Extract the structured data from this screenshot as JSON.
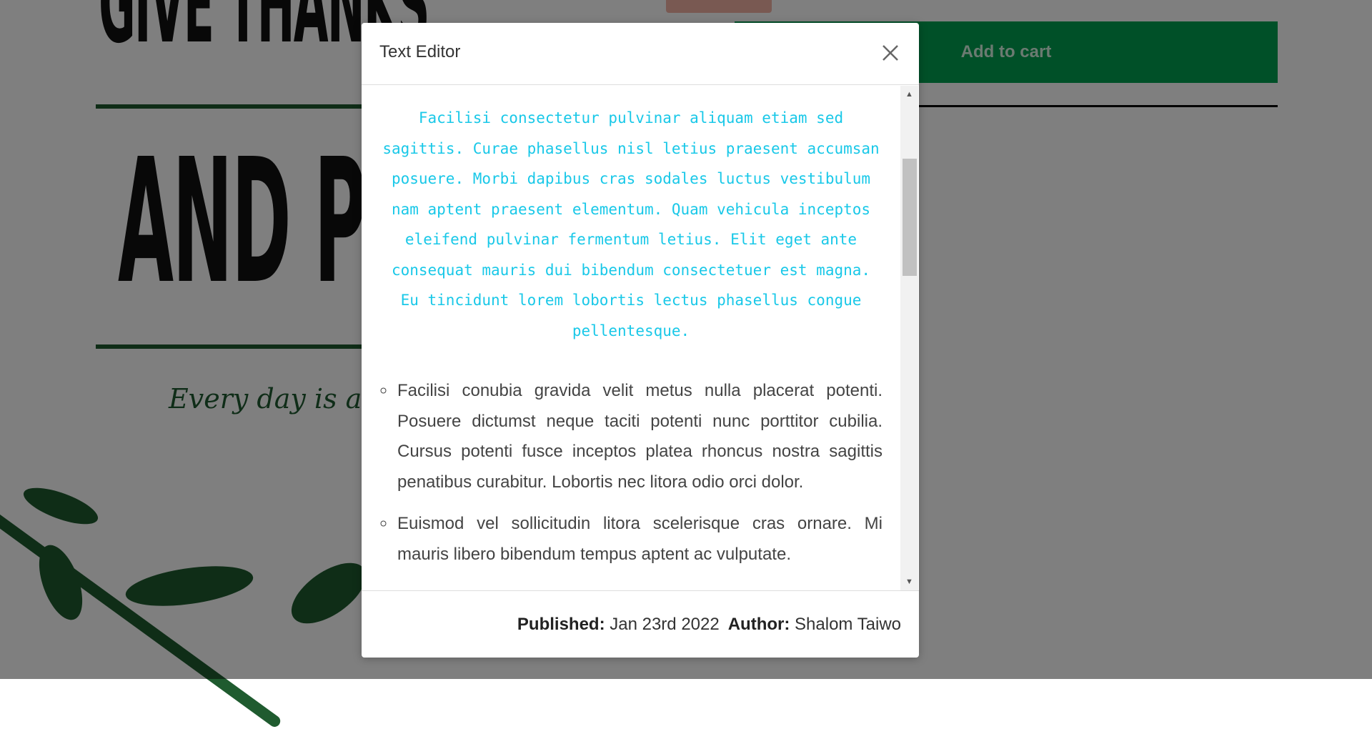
{
  "background": {
    "poster_line_1": "GIVE THANKS",
    "poster_line_2": "AND PRAISE",
    "tagline": "Every day is a blessing",
    "cart_button_label": "Add to cart",
    "colors": {
      "accent_green": "#00a050",
      "poster_green": "#1f5b2f"
    }
  },
  "modal": {
    "title": "Text Editor",
    "close_icon": "close-icon",
    "body": {
      "mono_paragraph": "Facilisi consectetur pulvinar aliquam etiam sed sagittis. Curae phasellus nisl letius praesent accumsan posuere. Morbi dapibus cras sodales luctus vestibulum nam aptent praesent elementum. Quam vehicula inceptos eleifend pulvinar fermentum letius. Elit eget ante consequat mauris dui bibendum consectetuer est magna. Eu tincidunt lorem lobortis lectus phasellus congue pellentesque.",
      "bullets": [
        "Facilisi conubia gravida velit metus nulla placerat potenti. Posuere dictumst neque taciti potenti nunc porttitor cubilia. Cursus potenti fusce inceptos platea rhoncus nostra sagittis penatibus curabitur. Lobortis nec litora odio orci dolor.",
        "Euismod vel sollicitudin litora scelerisque cras ornare. Mi mauris libero bibendum tempus aptent ac vulputate."
      ],
      "text_color": "#19c8e8"
    },
    "footer": {
      "published_label": "Published:",
      "published_value": "Jan 23rd 2022",
      "author_label": "Author:",
      "author_value": "Shalom Taiwo"
    }
  }
}
